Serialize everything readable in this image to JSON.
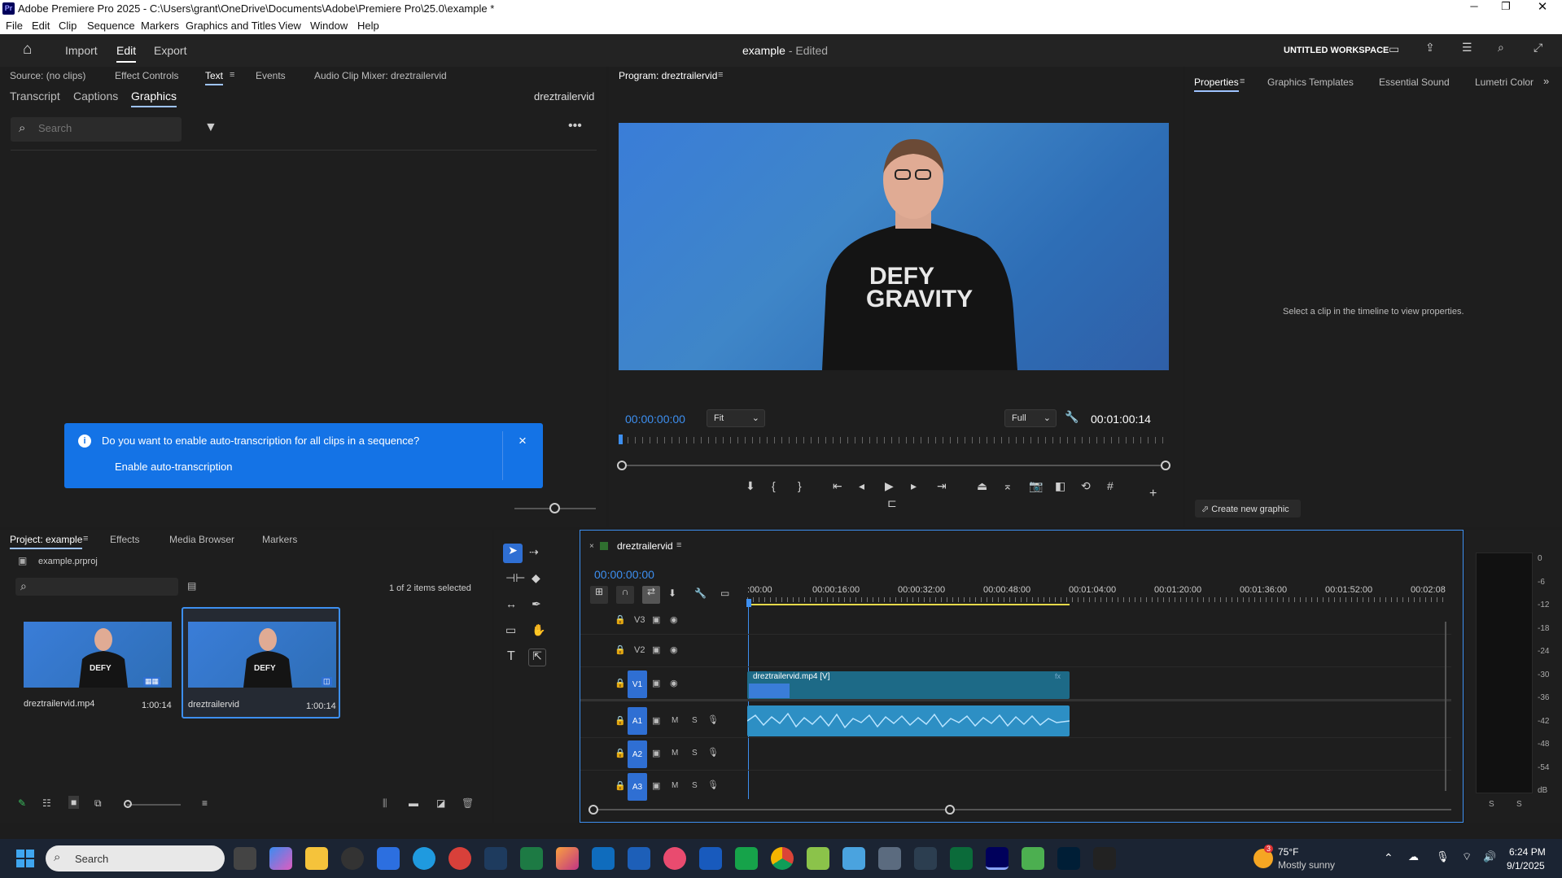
{
  "window": {
    "title": "Adobe Premiere Pro 2025 - C:\\Users\\grant\\OneDrive\\Documents\\Adobe\\Premiere Pro\\25.0\\example *"
  },
  "menu": [
    "File",
    "Edit",
    "Clip",
    "Sequence",
    "Markers",
    "Graphics and Titles",
    "View",
    "Window",
    "Help"
  ],
  "header": {
    "import": "Import",
    "edit": "Edit",
    "export": "Export",
    "project_title": "example",
    "edited": "- Edited",
    "workspace": "UNTITLED WORKSPACE"
  },
  "source_panel": {
    "tabs": [
      "Source: (no clips)",
      "Effect Controls",
      "Text",
      "Events",
      "Audio Clip Mixer: dreztrailervid"
    ],
    "subtabs": [
      "Transcript",
      "Captions",
      "Graphics"
    ],
    "sequence": "dreztrailervid",
    "search_placeholder": "Search"
  },
  "notification": {
    "text": "Do you want to enable auto-transcription for all clips in a sequence?",
    "action": "Enable auto-transcription",
    "close": "×"
  },
  "program": {
    "tab": "Program: dreztrailervid",
    "timecode": "00:00:00:00",
    "fit": "Fit",
    "quality": "Full",
    "duration": "00:01:00:14",
    "playhead": 0
  },
  "properties": {
    "tabs": [
      "Properties",
      "Graphics Templates",
      "Essential Sound",
      "Lumetri Color"
    ],
    "message": "Select a clip in the timeline to view properties.",
    "create_graphic": "Create new graphic"
  },
  "project": {
    "tabs": [
      "Project: example",
      "Effects",
      "Media Browser",
      "Markers"
    ],
    "file": "example.prproj",
    "selected": "1 of 2 items selected",
    "items": [
      {
        "name": "dreztrailervid.mp4",
        "duration": "1:00:14"
      },
      {
        "name": "dreztrailervid",
        "duration": "1:00:14"
      }
    ]
  },
  "timeline": {
    "sequence": "dreztrailervid",
    "timecode": "00:00:00:00",
    "ruler": [
      ":00:00",
      "00:00:16:00",
      "00:00:32:00",
      "00:00:48:00",
      "00:01:04:00",
      "00:01:20:00",
      "00:01:36:00",
      "00:01:52:00",
      "00:02:08"
    ],
    "video_tracks": [
      "V3",
      "V2",
      "V1"
    ],
    "audio_tracks": [
      "A1",
      "A2",
      "A3"
    ],
    "clip_label": "dreztrailervid.mp4 [V]",
    "m": "M",
    "s": "S"
  },
  "meter": {
    "labels": [
      "0",
      "-6",
      "-12",
      "-18",
      "-24",
      "-30",
      "-36",
      "-42",
      "-48",
      "-54",
      "dB"
    ],
    "channels": [
      "S",
      "S"
    ]
  },
  "taskbar": {
    "search": "Search",
    "temperature": "75°F",
    "weather": "Mostly sunny",
    "time": "6:24 PM",
    "date": "9/1/2025",
    "weather_badge": "3"
  },
  "colors": {
    "accent": "#2f6fd3",
    "notification": "#1473e6",
    "timecode": "#3d8ff0",
    "clip_video": "#1d6a87",
    "clip_audio": "#2d8fc4"
  }
}
